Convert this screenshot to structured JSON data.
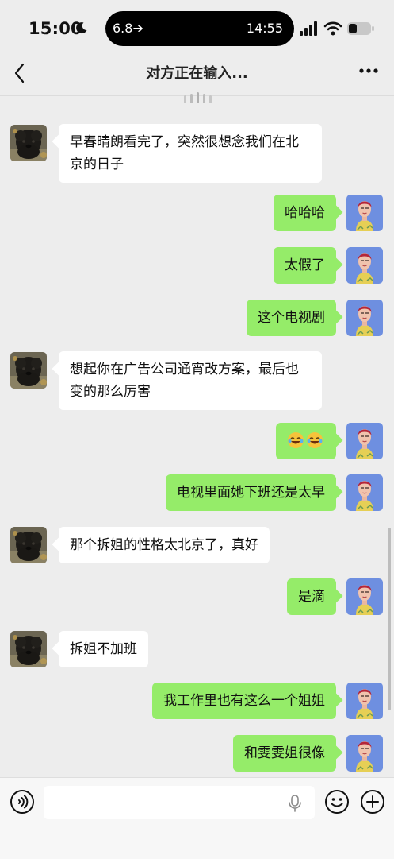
{
  "status_bar": {
    "time": "15:00",
    "island_left": "6.8➔",
    "island_right": "14:55",
    "icons": [
      "moon-icon",
      "signal-icon",
      "wifi-icon",
      "battery-icon"
    ]
  },
  "header": {
    "title": "对方正在输入...",
    "back_icon": "chevron-left-icon",
    "more_icon": "more-icon"
  },
  "colors": {
    "background": "#ededed",
    "incoming_bubble": "#ffffff",
    "outgoing_bubble": "#95ec69"
  },
  "messages": [
    {
      "side": "in",
      "text": "早春晴朗看完了，突然很想念我们在北京的日子"
    },
    {
      "side": "out",
      "text": "哈哈哈"
    },
    {
      "side": "out",
      "text": "太假了"
    },
    {
      "side": "out",
      "text": "这个电视剧"
    },
    {
      "side": "in",
      "text": "想起你在广告公司通宵改方案，最后也变的那么厉害"
    },
    {
      "side": "out",
      "text": "",
      "emoji": [
        "laughing-crying-emoji",
        "laughing-crying-emoji"
      ]
    },
    {
      "side": "out",
      "text": "电视里面她下班还是太早"
    },
    {
      "side": "in",
      "text": "那个拆姐的性格太北京了，真好"
    },
    {
      "side": "out",
      "text": "是滴"
    },
    {
      "side": "in",
      "text": "拆姐不加班"
    },
    {
      "side": "out",
      "text": "我工作里也有这么一个姐姐"
    },
    {
      "side": "out",
      "text": "和雯雯姐很像"
    }
  ],
  "input_bar": {
    "value": "",
    "icons": [
      "voice-icon",
      "microphone-icon",
      "emoji-icon",
      "plus-icon"
    ]
  }
}
